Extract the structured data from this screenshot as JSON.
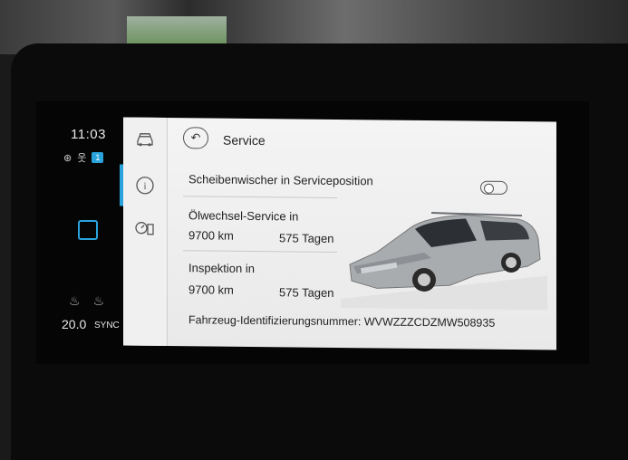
{
  "status_strip": {
    "time": "11:03",
    "badge_number": "1",
    "temperature": "20.0",
    "sync_label": "SYNC"
  },
  "header": {
    "title": "Service",
    "back_icon": "back-arrow-icon"
  },
  "nav": {
    "items": [
      {
        "icon": "car-icon"
      },
      {
        "icon": "info-icon",
        "active": true
      },
      {
        "icon": "fuel-service-icon"
      }
    ]
  },
  "wiper": {
    "label": "Scheibenwischer in Serviceposition",
    "toggle_on": false
  },
  "oil_service": {
    "label": "Ölwechsel-Service in",
    "distance": "9700 km",
    "days": "575 Tagen"
  },
  "inspection": {
    "label": "Inspektion in",
    "distance": "9700 km",
    "days": "575 Tagen"
  },
  "vin": {
    "text": "Fahrzeug-Identifizierungsnummer: WVWZZZCDZMW508935"
  },
  "colors": {
    "accent": "#2aa3dc",
    "panel_bg": "#f2f2f2",
    "car_body": "#a9acaf"
  }
}
